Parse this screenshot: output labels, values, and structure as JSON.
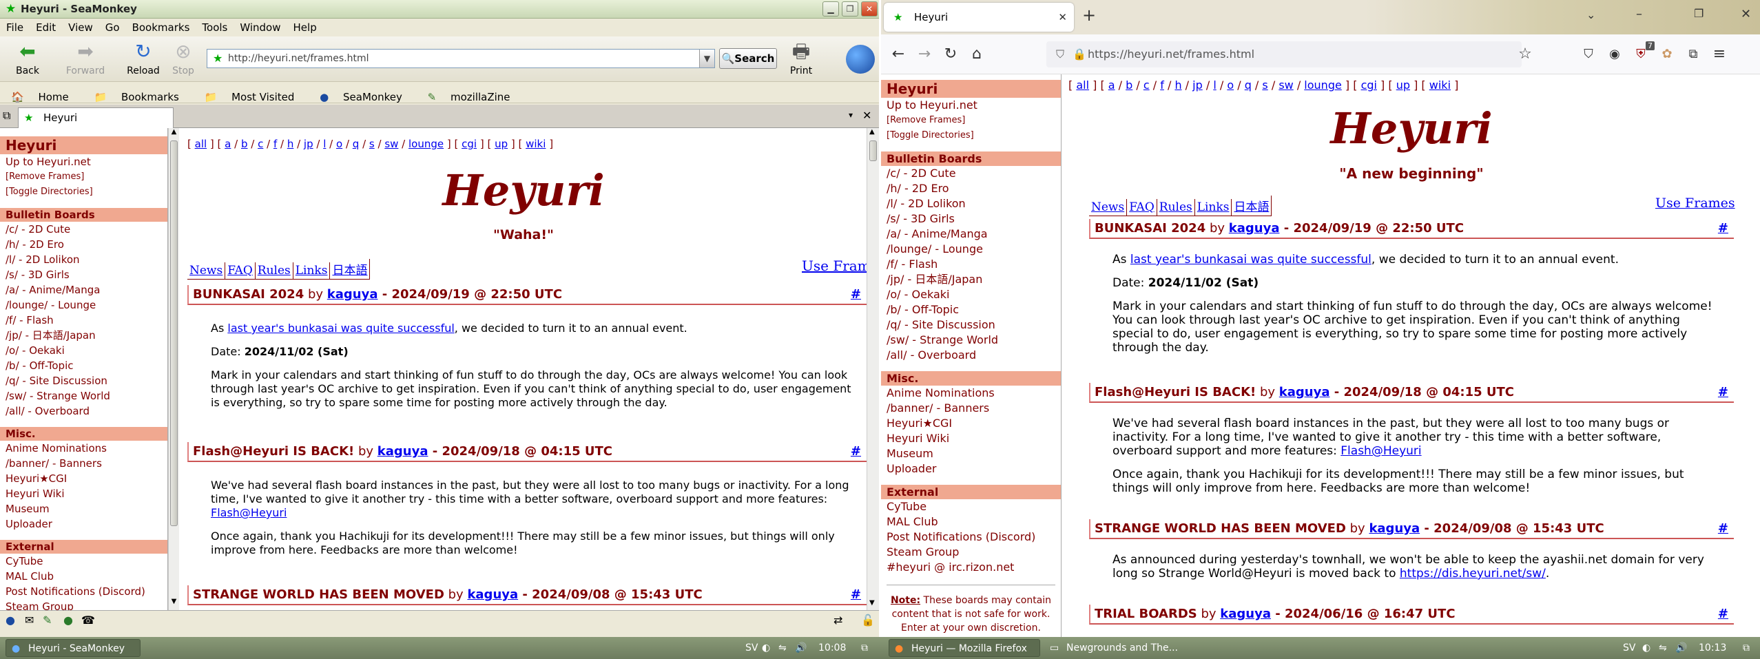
{
  "seamonkey": {
    "title": "Heyuri - SeaMonkey",
    "menu": [
      "File",
      "Edit",
      "View",
      "Go",
      "Bookmarks",
      "Tools",
      "Window",
      "Help"
    ],
    "nav": {
      "back": "Back",
      "forward": "Forward",
      "reload": "Reload",
      "stop": "Stop",
      "print": "Print"
    },
    "url": "http://heyuri.net/frames.html",
    "search_label": "Search",
    "bookmarks": [
      "Home",
      "Bookmarks",
      "Most Visited",
      "SeaMonkey",
      "mozillaZine"
    ],
    "tab_title": "Heyuri"
  },
  "firefox": {
    "tab_title": "Heyuri",
    "url": "https://heyuri.net/frames.html",
    "badge": "7"
  },
  "sidebar": {
    "title": "Heyuri",
    "up": "Up to Heyuri.net",
    "remove_frames": "[Remove Frames]",
    "toggle_dirs": "[Toggle Directories]",
    "boards_heading": "Bulletin Boards",
    "boards": [
      "/c/ - 2D Cute",
      "/h/ - 2D Ero",
      "/l/ - 2D Lolikon",
      "/s/ - 3D Girls",
      "/a/ - Anime/Manga",
      "/lounge/ - Lounge",
      "/f/ - Flash",
      "/jp/ - 日本語/Japan",
      "/o/ - Oekaki",
      "/b/ - Off-Topic",
      "/q/ - Site Discussion",
      "/sw/ - Strange World",
      "/all/ - Overboard"
    ],
    "misc_heading": "Misc.",
    "misc": [
      "Anime Nominations",
      "/banner/ - Banners",
      "Heyuri★CGI",
      "Heyuri Wiki",
      "Museum",
      "Uploader"
    ],
    "external_heading": "External",
    "external": [
      "CyTube",
      "MAL Club",
      "Post Notifications (Discord)",
      "Steam Group",
      "#heyuri @ irc.rizon.net"
    ],
    "note_label": "Note:",
    "note_text": " These boards may contain content that is not safe for work. Enter at your own discretion."
  },
  "news": {
    "boards_prefix": "[ ",
    "board_links": [
      "all",
      "a",
      "b",
      "c",
      "f",
      "h",
      "jp",
      "l",
      "o",
      "q",
      "s",
      "sw",
      "lounge"
    ],
    "cgi": "cgi",
    "up": "up",
    "wiki": "wiki",
    "logo": "Heyuri",
    "motto_left": "\"Waha!\"",
    "motto_right": "\"A new beginning\"",
    "tabs": [
      "News",
      "FAQ",
      "Rules",
      "Links",
      "日本語"
    ],
    "use_frames": "Use Frames",
    "posts": [
      {
        "title": "BUNKASAI 2024",
        "by": " by ",
        "user": "kaguya",
        "date": " - 2024/09/19 @ 22:50 UTC",
        "hash": "#",
        "p1_pre": "As ",
        "p1_link": "last year's bunkasai was quite successful",
        "p1_post": ", we decided to turn it to an annual event.",
        "p2_label": "Date: ",
        "p2_value": "2024/11/02 (Sat)",
        "p3": "Mark in your calendars and start thinking of fun stuff to do through the day, OCs are always welcome! You can look through last year's OC archive to get inspiration. Even if you can't think of anything special to do, user engagement is everything, so try to spare some time for posting more actively through the day."
      },
      {
        "title": "Flash@Heyuri IS BACK!",
        "by": " by ",
        "user": "kaguya",
        "date": " - 2024/09/18 @ 04:15 UTC",
        "hash": "#",
        "p1": "We've had several flash board instances in the past, but they were all lost to too many bugs or inactivity. For a long time, I've wanted to give it another try - this time with a better software, overboard support and more features: ",
        "p1_link": "Flash@Heyuri",
        "p2": "Once again, thank you Hachikuji for its development!!! There may still be a few minor issues, but things will only improve from here. Feedbacks are more than welcome!"
      },
      {
        "title": "STRANGE WORLD HAS BEEN MOVED",
        "by": " by ",
        "user": "kaguya",
        "date": " - 2024/09/08 @ 15:43 UTC",
        "hash": "#",
        "p1": "As announced during yesterday's townhall, we won't be able to keep the ayashii.net domain for very long so Strange World@Heyuri is moved back to ",
        "p1_link": "https://dis.heyuri.net/sw/",
        "p1_end": "."
      },
      {
        "title": "TRIAL BOARDS",
        "by": " by ",
        "user": "kaguya",
        "date": " - 2024/06/16 @ 16:47 UTC",
        "hash": "#"
      }
    ]
  },
  "taskbar": {
    "left_button": "Heyuri - SeaMonkey",
    "left_lang": "SV",
    "left_clock": "10:08",
    "ff_button": "Heyuri — Mozilla Firefox",
    "ng_button": "Newgrounds and The...",
    "right_lang": "SV",
    "right_clock": "10:13"
  }
}
